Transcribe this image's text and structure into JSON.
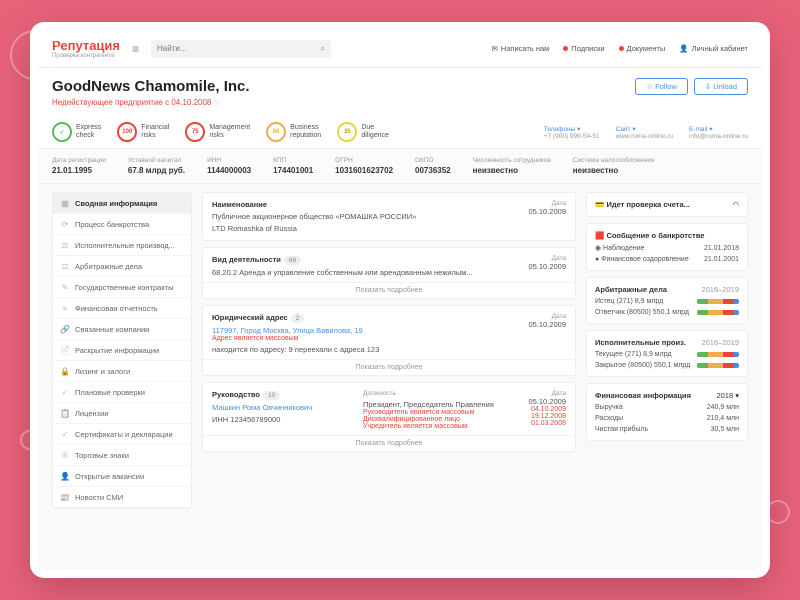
{
  "logo": {
    "main": "епутация",
    "prefix": "Р",
    "sub": "Проверка контрагента"
  },
  "search": {
    "placeholder": "Найти..."
  },
  "headerLinks": [
    "Написать нам",
    "Подписки",
    "Документы",
    "Личный кабинет"
  ],
  "title": "GoodNews Chamomile, Inc.",
  "subtitle": "Недействующее предприятие с 04.10.2008",
  "buttons": {
    "follow": "☆ Follow",
    "unload": "⇩ Unload"
  },
  "risks": [
    {
      "val": "✓",
      "label": "Express\ncheck",
      "cls": "rg"
    },
    {
      "val": "100",
      "label": "Financial\nrisks",
      "cls": "rr"
    },
    {
      "val": "75",
      "label": "Management\nrisks",
      "cls": "rr"
    },
    {
      "val": "50",
      "label": "Business\nreputation",
      "cls": "ro"
    },
    {
      "val": "35",
      "label": "Due\ndiligence",
      "cls": "ry"
    }
  ],
  "contacts": [
    {
      "l": "Телефоны ▾",
      "v": "+7 (900) 999-54-51"
    },
    {
      "l": "Сайт ▾",
      "v": "www.roma-online.ru"
    },
    {
      "l": "E-mail ▾",
      "v": "info@roma-online.ru"
    }
  ],
  "meta": [
    {
      "l": "Дата регистрации",
      "v": "21.01.1995"
    },
    {
      "l": "Уставной капитал",
      "v": "67.8 млрд руб."
    },
    {
      "l": "ИНН",
      "v": "1144000003"
    },
    {
      "l": "КПП",
      "v": "174401001"
    },
    {
      "l": "ОГРН",
      "v": "1031601623702"
    },
    {
      "l": "ОКПО",
      "v": "00736352"
    },
    {
      "l": "Численность сотрудников",
      "v": "неизвестно"
    },
    {
      "l": "Система налогообложения",
      "v": "неизвестно"
    }
  ],
  "sidebar": [
    "Сводная информация",
    "Процесс банкротства",
    "Исполнительные производ...",
    "Арбитражные дела",
    "Государственные контракты",
    "Финансовая отчетность",
    "Связанные компании",
    "Раскрытие информации",
    "Лизинг и залоги",
    "Плановые проверки",
    "Лицензии",
    "Сертификаты и декларации",
    "Торговые знаки",
    "Открытые вакансии",
    "Новости СМИ"
  ],
  "cards": {
    "name": {
      "title": "Наименование",
      "line1": "Публичное акционерное общество «РОМАШКА РОССИИ»",
      "line2": "LTD Romashka of Russia",
      "dateL": "Дата",
      "date": "05.10.2009"
    },
    "activity": {
      "title": "Вид деятельности",
      "badge": "68",
      "text": "68.20.2 Аренда и управление собственным или арендованным нежилым...",
      "dateL": "Дата",
      "date": "05.10.2009",
      "more": "Показать подробнее"
    },
    "address": {
      "title": "Юридический адрес",
      "badge": "2",
      "link": "117997, Город Москва, Улица Вавилова, 19",
      "warn": "Адрес является массовым",
      "extra": "находится по адресу: 9   переехали с адреса 123",
      "dateL": "Дата",
      "date": "05.10.2009",
      "more": "Показать подробнее"
    },
    "mgmt": {
      "title": "Руководство",
      "badge": "10",
      "name": "Машкин Рома Овчинникович",
      "inn": "ИНН 123456789000",
      "posL": "Должность",
      "pos": "Президент, Председатель Правления",
      "dateL": "Дата",
      "date": "05.10.2009",
      "warns": [
        {
          "t": "Руководитель является массовым",
          "d": "04.10.2009"
        },
        {
          "t": "Дисквалифицированное лицо",
          "d": "19.12.2008"
        },
        {
          "t": "Учредитель является массовым",
          "d": "01.03.2008"
        }
      ],
      "more": "Показать подробнее"
    }
  },
  "right": {
    "check": "Идет проверка счета...",
    "bank": {
      "title": "Сообщение о банкротстве",
      "rows": [
        {
          "t": "Наблюдение",
          "d": "21.01.2018"
        },
        {
          "t": "Финансовое оздоровление",
          "d": "21.01.2001"
        }
      ]
    },
    "arb": {
      "title": "Арбитражные дела",
      "range": "2016–2019",
      "rows": [
        {
          "t": "Истец (271) 8,9 млрд"
        },
        {
          "t": "Ответчик (80500) 550,1 млрд"
        }
      ]
    },
    "exec": {
      "title": "Исполнительные произ.",
      "range": "2016–2019",
      "rows": [
        {
          "t": "Текущее (271) 8,9 млрд"
        },
        {
          "t": "Закрытое (80500) 550,1 млрд"
        }
      ]
    },
    "fin": {
      "title": "Финансовая информация",
      "year": "2018 ▾",
      "rows": [
        {
          "t": "Выручка",
          "v": "240,9 млн"
        },
        {
          "t": "Расходы",
          "v": "210,4 млн"
        },
        {
          "t": "Чистая прибыль",
          "v": "30,5 млн"
        }
      ]
    }
  }
}
